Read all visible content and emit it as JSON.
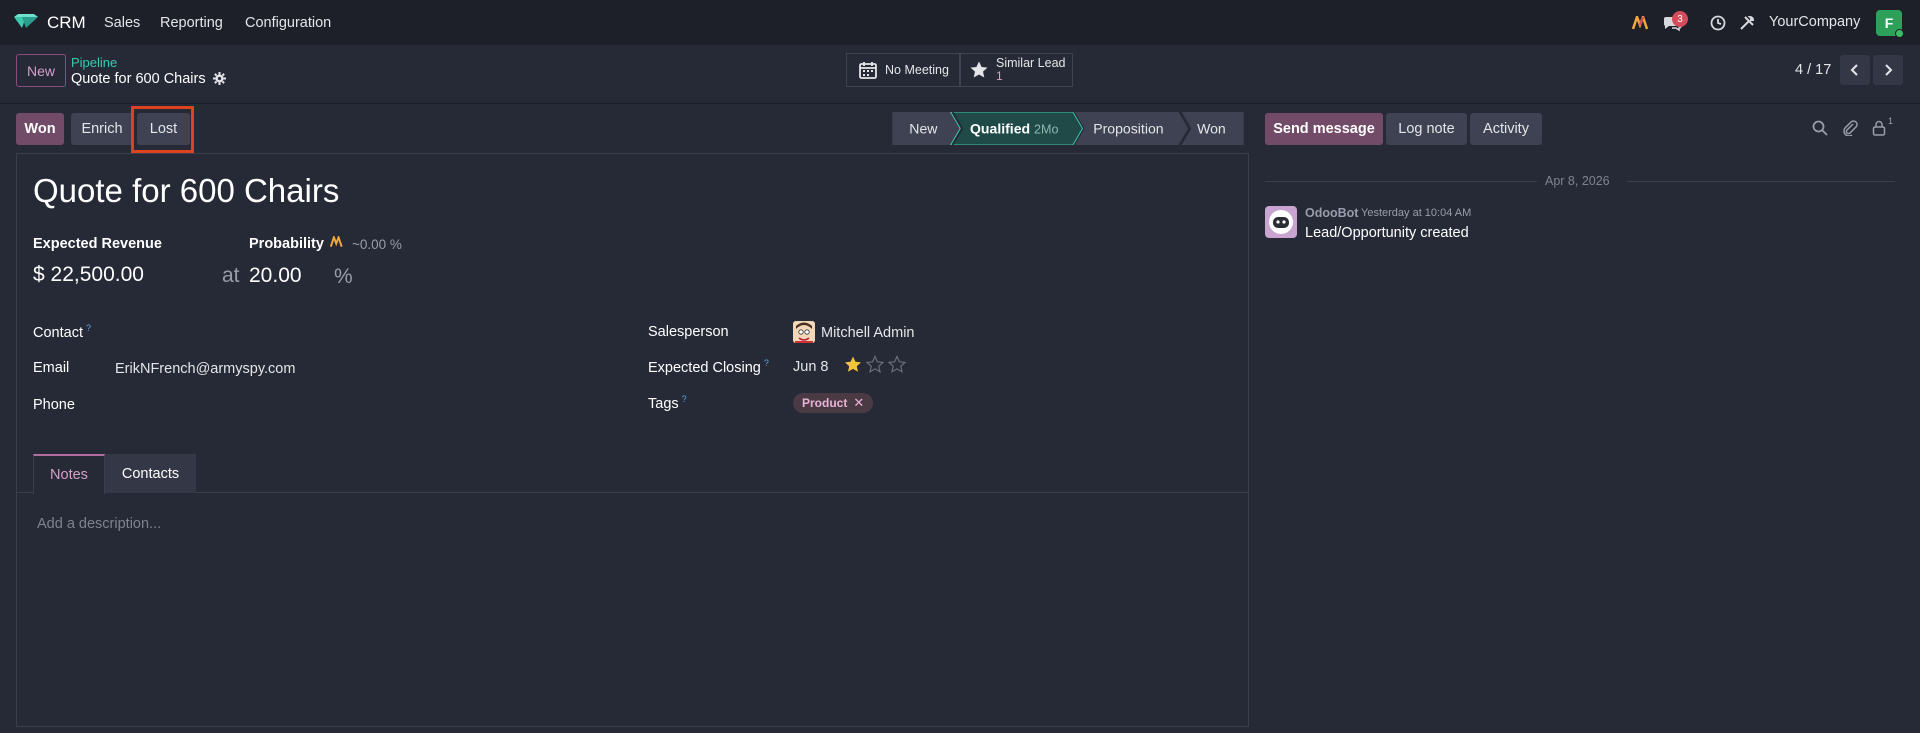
{
  "navbar": {
    "app_name": "CRM",
    "menus": [
      "Sales",
      "Reporting",
      "Configuration"
    ],
    "messages_count": "3",
    "company": "YourCompany",
    "user_initial": "F"
  },
  "control_panel": {
    "new_label": "New",
    "breadcrumb_parent": "Pipeline",
    "breadcrumb_current": "Quote for 600 Chairs",
    "smart_buttons": {
      "meeting_label": "No Meeting",
      "similar_label": "Similar Lead",
      "similar_value": "1"
    },
    "pager": "4 / 17"
  },
  "status_buttons": {
    "won": "Won",
    "enrich": "Enrich",
    "lost": "Lost"
  },
  "stages": {
    "items": [
      "New",
      "Qualified",
      "Proposition",
      "Won"
    ],
    "active_duration": "2Mo",
    "active_index": 1
  },
  "form": {
    "title": "Quote for 600 Chairs",
    "expected_revenue_label": "Expected Revenue",
    "expected_revenue_value": "$ 22,500.00",
    "at_label": "at",
    "probability_label": "Probability",
    "probability_ai": "~0.00 %",
    "probability_value": "20.00",
    "percent_sign": "%",
    "contact_label": "Contact",
    "email_label": "Email",
    "email_value": "ErikNFrench@armyspy.com",
    "phone_label": "Phone",
    "salesperson_label": "Salesperson",
    "salesperson_value": "Mitchell Admin",
    "expected_closing_label": "Expected Closing",
    "expected_closing_value": "Jun 8",
    "priority_stars": 1,
    "tags_label": "Tags",
    "tag_product": "Product",
    "help_mark": "?",
    "tabs": [
      "Notes",
      "Contacts"
    ],
    "description_placeholder": "Add a description..."
  },
  "chatter": {
    "send_message": "Send message",
    "log_note": "Log note",
    "activity": "Activity",
    "followers_count": "1",
    "date_separator": "Apr 8, 2026",
    "message_author": "OdooBot",
    "message_time": "Yesterday at 10:04 AM",
    "message_body": "Lead/Opportunity created"
  },
  "colors": {
    "primary": "#714b67",
    "stage_active_border": "#3dc8b0",
    "highlight": "#e0411f"
  }
}
